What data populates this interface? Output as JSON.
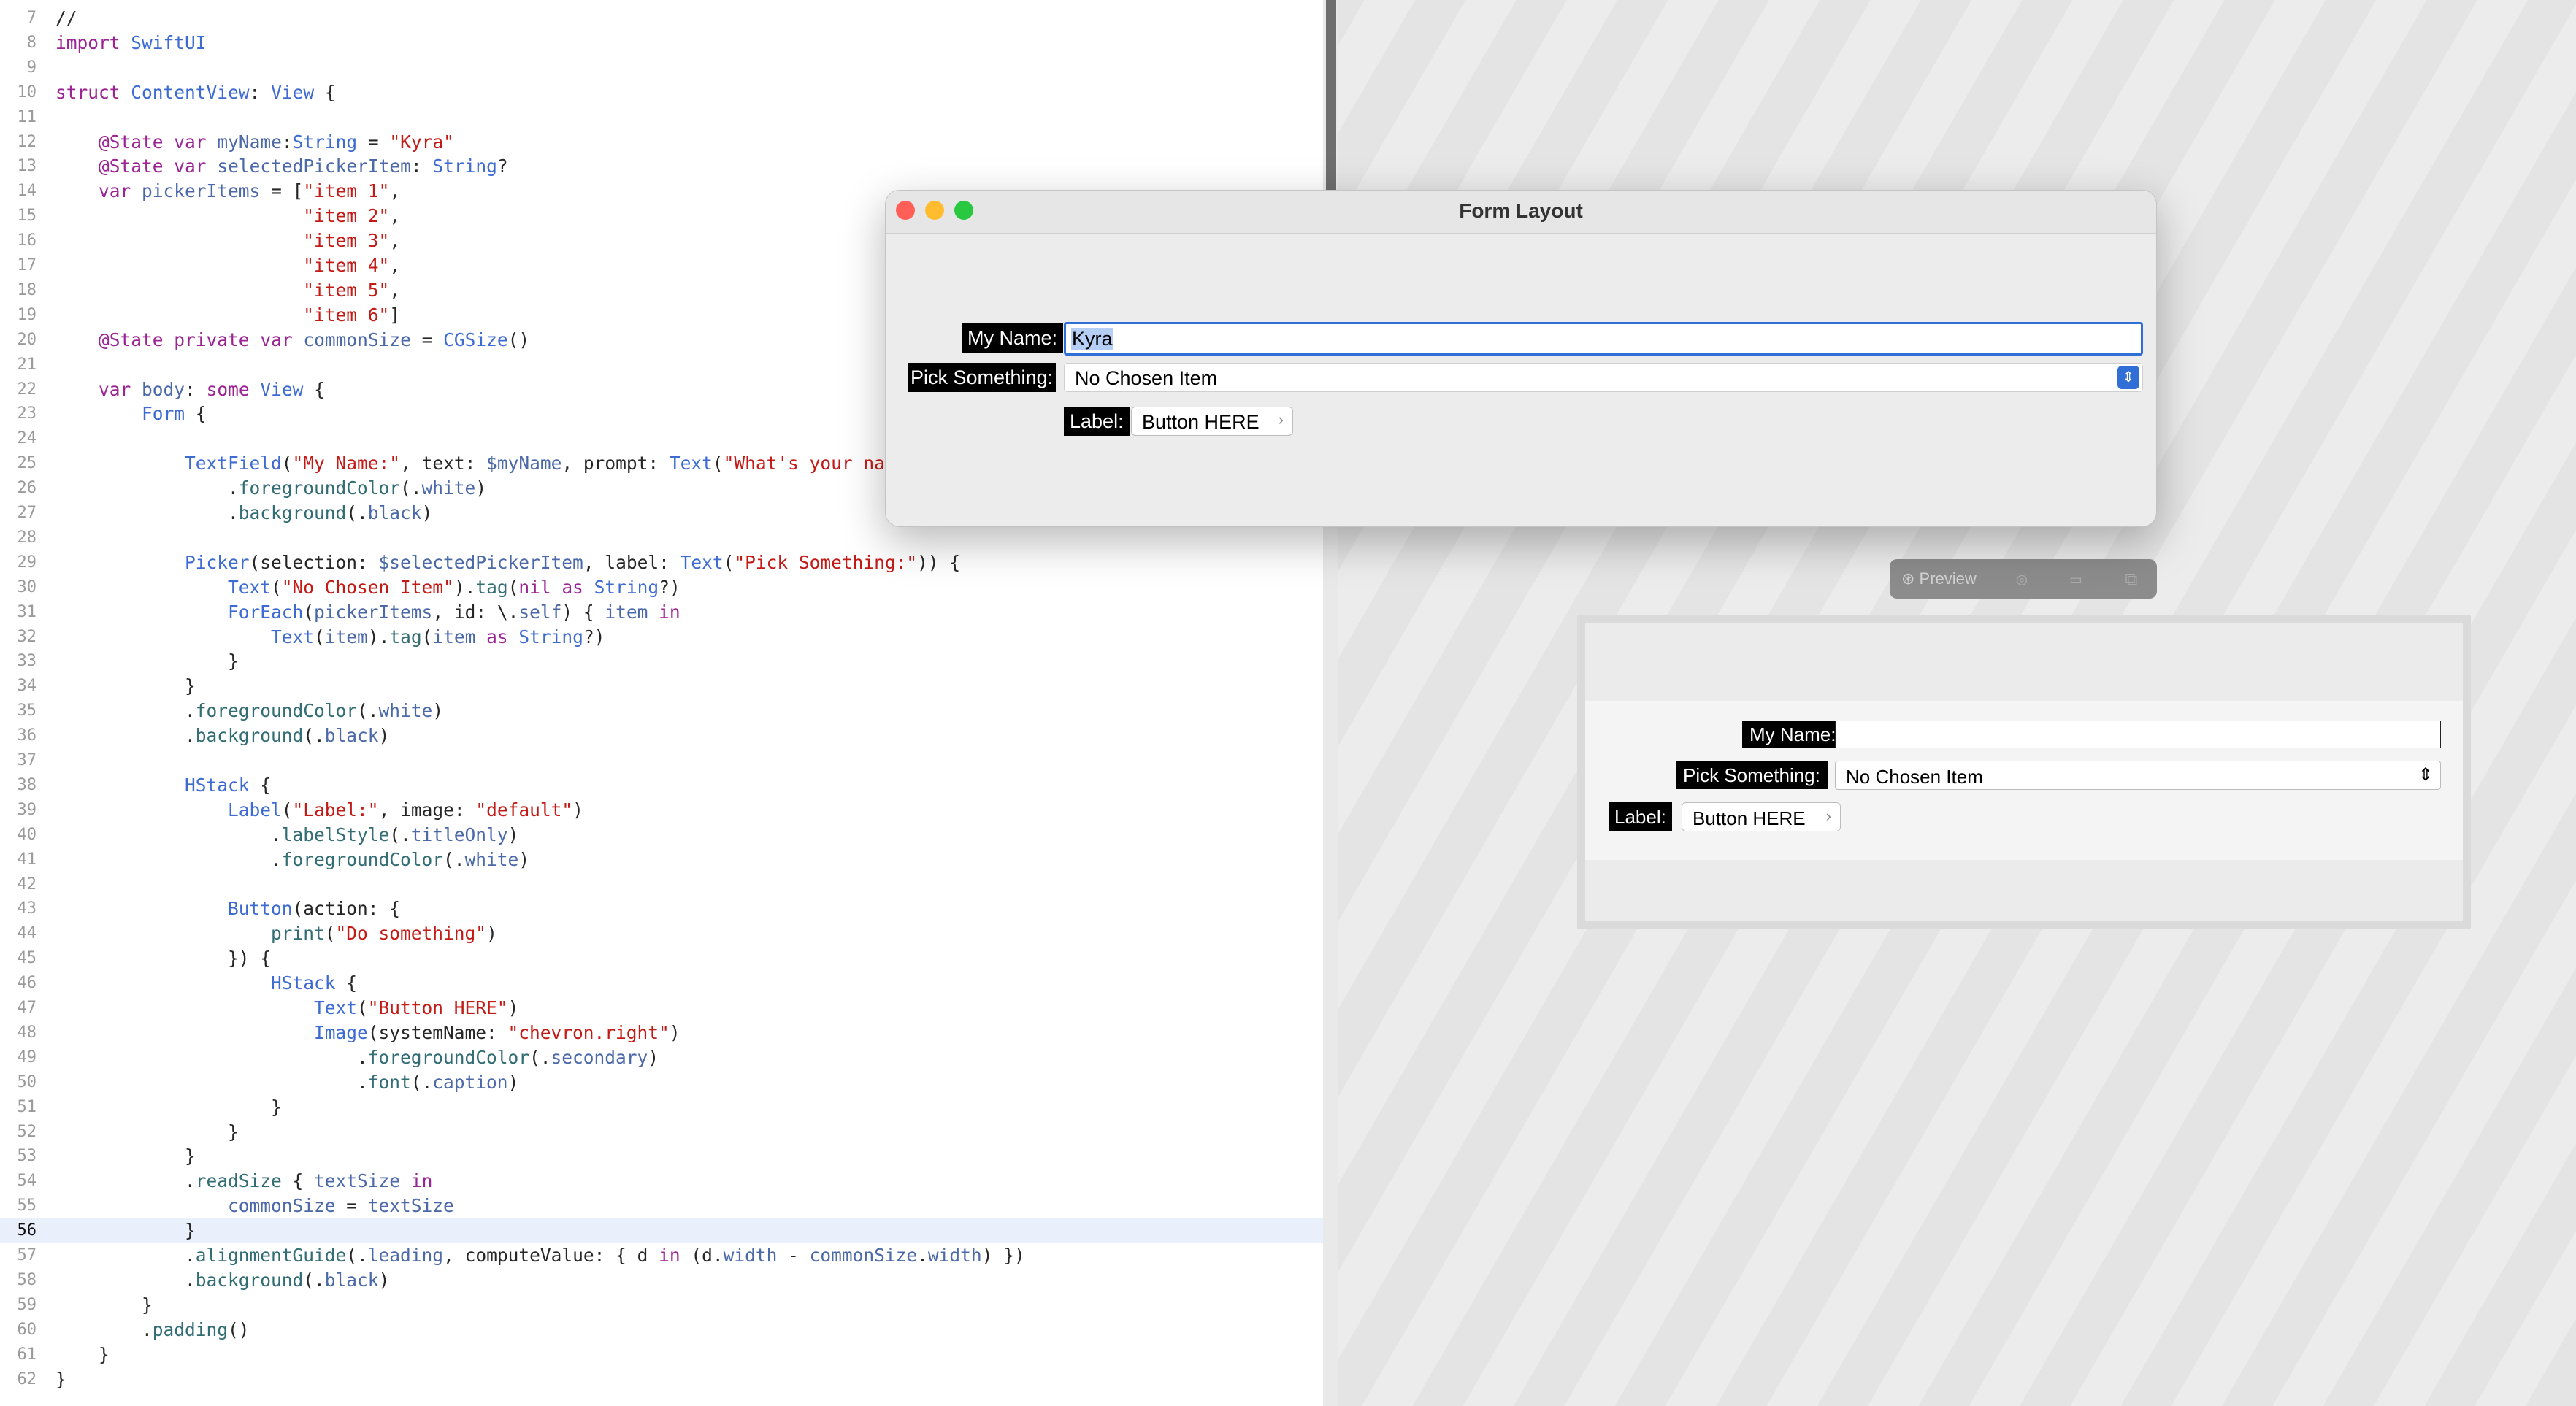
{
  "editor": {
    "current_line": "56",
    "lines": [
      {
        "n": "7",
        "code": "//"
      },
      {
        "n": "8",
        "code": "import SwiftUI"
      },
      {
        "n": "9",
        "code": ""
      },
      {
        "n": "10",
        "code": "struct ContentView: View {"
      },
      {
        "n": "11",
        "code": ""
      },
      {
        "n": "12",
        "code": "    @State var myName:String = \"Kyra\""
      },
      {
        "n": "13",
        "code": "    @State var selectedPickerItem: String?"
      },
      {
        "n": "14",
        "code": "    var pickerItems = [\"item 1\","
      },
      {
        "n": "15",
        "code": "                       \"item 2\","
      },
      {
        "n": "16",
        "code": "                       \"item 3\","
      },
      {
        "n": "17",
        "code": "                       \"item 4\","
      },
      {
        "n": "18",
        "code": "                       \"item 5\","
      },
      {
        "n": "19",
        "code": "                       \"item 6\"]"
      },
      {
        "n": "20",
        "code": "    @State private var commonSize = CGSize()"
      },
      {
        "n": "21",
        "code": ""
      },
      {
        "n": "22",
        "code": "    var body: some View {"
      },
      {
        "n": "23",
        "code": "        Form {"
      },
      {
        "n": "24",
        "code": ""
      },
      {
        "n": "25",
        "code": "            TextField(\"My Name:\", text: $myName, prompt: Text(\"What's your na"
      },
      {
        "n": "26",
        "code": "                .foregroundColor(.white)"
      },
      {
        "n": "27",
        "code": "                .background(.black)"
      },
      {
        "n": "28",
        "code": ""
      },
      {
        "n": "29",
        "code": "            Picker(selection: $selectedPickerItem, label: Text(\"Pick Something:\")) {"
      },
      {
        "n": "30",
        "code": "                Text(\"No Chosen Item\").tag(nil as String?)"
      },
      {
        "n": "31",
        "code": "                ForEach(pickerItems, id: \\.self) { item in"
      },
      {
        "n": "32",
        "code": "                    Text(item).tag(item as String?)"
      },
      {
        "n": "33",
        "code": "                }"
      },
      {
        "n": "34",
        "code": "            }"
      },
      {
        "n": "35",
        "code": "            .foregroundColor(.white)"
      },
      {
        "n": "36",
        "code": "            .background(.black)"
      },
      {
        "n": "37",
        "code": ""
      },
      {
        "n": "38",
        "code": "            HStack {"
      },
      {
        "n": "39",
        "code": "                Label(\"Label:\", image: \"default\")"
      },
      {
        "n": "40",
        "code": "                    .labelStyle(.titleOnly)"
      },
      {
        "n": "41",
        "code": "                    .foregroundColor(.white)"
      },
      {
        "n": "42",
        "code": ""
      },
      {
        "n": "43",
        "code": "                Button(action: {"
      },
      {
        "n": "44",
        "code": "                    print(\"Do something\")"
      },
      {
        "n": "45",
        "code": "                }) {"
      },
      {
        "n": "46",
        "code": "                    HStack {"
      },
      {
        "n": "47",
        "code": "                        Text(\"Button HERE\")"
      },
      {
        "n": "48",
        "code": "                        Image(systemName: \"chevron.right\")"
      },
      {
        "n": "49",
        "code": "                            .foregroundColor(.secondary)"
      },
      {
        "n": "50",
        "code": "                            .font(.caption)"
      },
      {
        "n": "51",
        "code": "                    }"
      },
      {
        "n": "52",
        "code": "                }"
      },
      {
        "n": "53",
        "code": "            }"
      },
      {
        "n": "54",
        "code": "            .readSize { textSize in"
      },
      {
        "n": "55",
        "code": "                commonSize = textSize"
      },
      {
        "n": "56",
        "code": "            }"
      },
      {
        "n": "57",
        "code": "            .alignmentGuide(.leading, computeValue: { d in (d.width - commonSize.width) })"
      },
      {
        "n": "58",
        "code": "            .background(.black)"
      },
      {
        "n": "59",
        "code": "        }"
      },
      {
        "n": "60",
        "code": "        .padding()"
      },
      {
        "n": "61",
        "code": "    }"
      },
      {
        "n": "62",
        "code": "}"
      }
    ]
  },
  "window": {
    "title": "Form Layout",
    "traffic_lights": {
      "close": "#ff5f57",
      "minimize": "#febc2e",
      "zoom": "#28c840"
    },
    "name_label": "My Name:",
    "name_value": "Kyra",
    "picker_label": "Pick Something:",
    "picker_value": "No Chosen Item",
    "label_text": "Label:",
    "button_label": "Button HERE",
    "accent": "#2f6fd6"
  },
  "preview_toolbar": {
    "label": "Preview",
    "icons": [
      "play-icon",
      "inspect-icon",
      "device-icon",
      "duplicate-icon"
    ]
  },
  "preview": {
    "name_label": "My Name:",
    "name_value": "",
    "picker_label": "Pick Something:",
    "picker_value": "No Chosen Item",
    "label_text": "Label:",
    "button_label": "Button HERE"
  }
}
